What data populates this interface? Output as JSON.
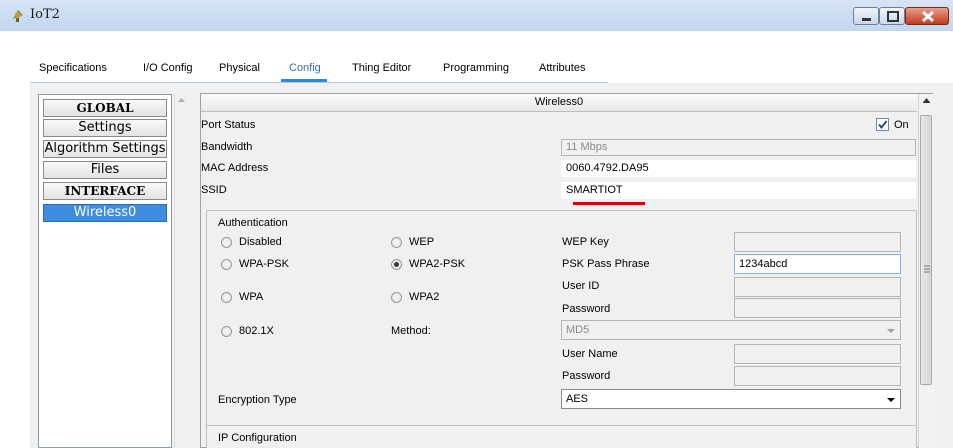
{
  "window": {
    "title": "IoT2"
  },
  "tabs": [
    {
      "label": "Specifications"
    },
    {
      "label": "I/O Config"
    },
    {
      "label": "Physical"
    },
    {
      "label": "Config"
    },
    {
      "label": "Thing Editor"
    },
    {
      "label": "Programming"
    },
    {
      "label": "Attributes"
    }
  ],
  "active_tab": "Config",
  "sidebar": {
    "items": [
      {
        "label": "GLOBAL"
      },
      {
        "label": "Settings"
      },
      {
        "label": "Algorithm Settings"
      },
      {
        "label": "Files"
      },
      {
        "label": "INTERFACE"
      },
      {
        "label": "Wireless0"
      }
    ],
    "selected": "Wireless0"
  },
  "panel": {
    "title": "Wireless0",
    "port_status": {
      "label": "Port Status",
      "checkbox_label": "On",
      "checked": true
    },
    "bandwidth": {
      "label": "Bandwidth",
      "value": "11 Mbps"
    },
    "mac": {
      "label": "MAC Address",
      "value": "0060.4792.DA95"
    },
    "ssid": {
      "label": "SSID",
      "value": "SMARTIOT"
    },
    "auth": {
      "title": "Authentication",
      "options": [
        {
          "label": "Disabled",
          "selected": false
        },
        {
          "label": "WEP",
          "selected": false
        },
        {
          "label": "WPA-PSK",
          "selected": false
        },
        {
          "label": "WPA2-PSK",
          "selected": true
        },
        {
          "label": "WPA",
          "selected": false
        },
        {
          "label": "WPA2",
          "selected": false
        },
        {
          "label": "802.1X",
          "selected": false
        }
      ],
      "method_label": "Method:",
      "wep_key_label": "WEP Key",
      "wep_key_value": "",
      "psk_label": "PSK Pass Phrase",
      "psk_value": "1234abcd",
      "user_id_label": "User ID",
      "password_label": "Password",
      "method_value": "MD5",
      "user_name_label": "User Name",
      "password2_label": "Password",
      "encryption_label": "Encryption Type",
      "encryption_value": "AES"
    },
    "ip_config_label": "IP Configuration"
  },
  "colors": {
    "accent": "#2a8ad4",
    "highlight": "#e00000",
    "selected_item": "#3f8de0"
  }
}
